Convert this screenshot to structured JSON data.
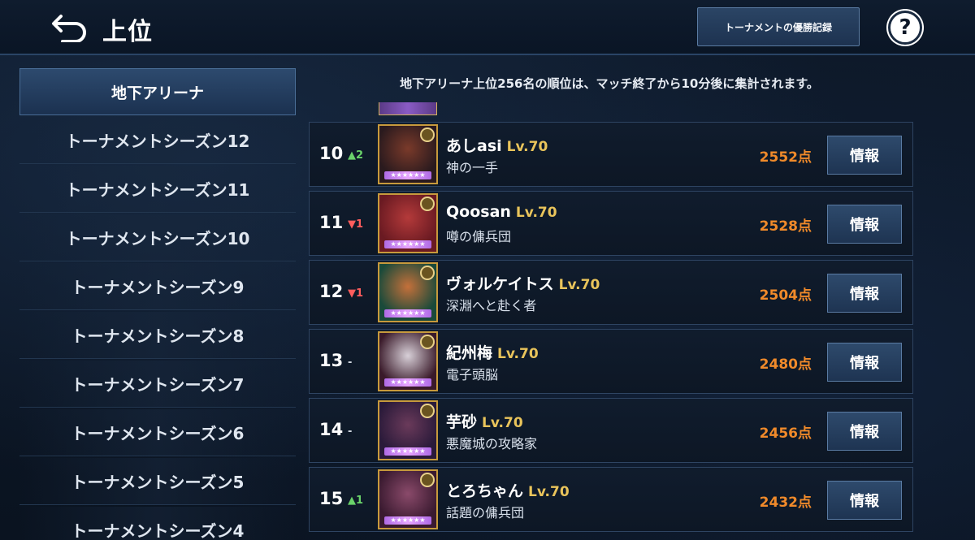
{
  "header": {
    "title": "上位",
    "record_button": "トーナメントの優勝記録",
    "help": "?"
  },
  "sidebar": {
    "items": [
      {
        "label": "地下アリーナ",
        "active": true
      },
      {
        "label": "トーナメントシーズン12"
      },
      {
        "label": "トーナメントシーズン11"
      },
      {
        "label": "トーナメントシーズン10"
      },
      {
        "label": "トーナメントシーズン9"
      },
      {
        "label": "トーナメントシーズン8"
      },
      {
        "label": "トーナメントシーズン7"
      },
      {
        "label": "トーナメントシーズン6"
      },
      {
        "label": "トーナメントシーズン5"
      },
      {
        "label": "トーナメントシーズン4"
      }
    ]
  },
  "notice": "地下アリーナ上位256名の順位は、マッチ終了から10分後に集計されます。",
  "rows": [
    {
      "rank": "10",
      "delta": "▲2",
      "delta_dir": "up",
      "name": "あしasi",
      "level": "Lv.70",
      "title": "神の一手",
      "score": "2552点",
      "info": "情報",
      "avatar_colors": [
        "#2a1a1e",
        "#7a3a2a"
      ]
    },
    {
      "rank": "11",
      "delta": "▼1",
      "delta_dir": "down",
      "name": "Qoosan",
      "level": "Lv.70",
      "title": "噂の傭兵団",
      "score": "2528点",
      "info": "情報",
      "avatar_colors": [
        "#6a1a22",
        "#b43a3a"
      ]
    },
    {
      "rank": "12",
      "delta": "▼1",
      "delta_dir": "down",
      "name": "ヴォルケイトス",
      "level": "Lv.70",
      "title": "深淵へと赴く者",
      "score": "2504点",
      "info": "情報",
      "avatar_colors": [
        "#1a4a3a",
        "#c4703a"
      ]
    },
    {
      "rank": "13",
      "delta": "-",
      "delta_dir": "same",
      "name": "紀州梅",
      "level": "Lv.70",
      "title": "電子頭脳",
      "score": "2480点",
      "info": "情報",
      "avatar_colors": [
        "#3a1a2a",
        "#d8d0d8"
      ]
    },
    {
      "rank": "14",
      "delta": "-",
      "delta_dir": "same",
      "name": "芋砂",
      "level": "Lv.70",
      "title": "悪魔城の攻略家",
      "score": "2456点",
      "info": "情報",
      "avatar_colors": [
        "#2a1a3a",
        "#6a3a5a"
      ]
    },
    {
      "rank": "15",
      "delta": "▲1",
      "delta_dir": "up",
      "name": "とろちゃん",
      "level": "Lv.70",
      "title": "話題の傭兵団",
      "score": "2432点",
      "info": "情報",
      "avatar_colors": [
        "#3a1a30",
        "#8a4a6a"
      ]
    }
  ],
  "colors": {
    "accent_gold": "#e9c45b",
    "score_orange": "#f08a2a",
    "up_green": "#6ad36a",
    "down_red": "#ff5d5d"
  }
}
